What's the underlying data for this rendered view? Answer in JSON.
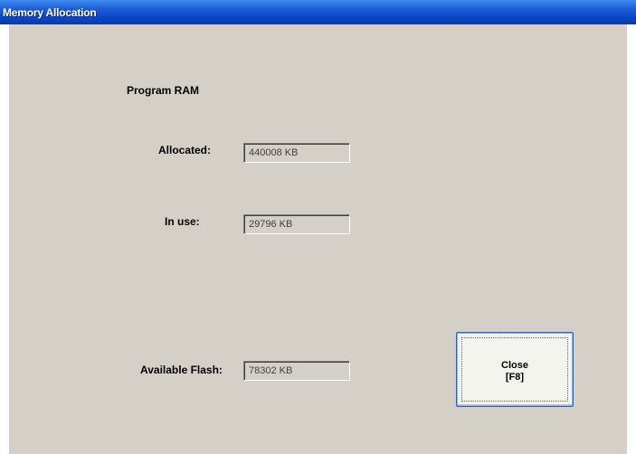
{
  "window": {
    "title": "Memory Allocation"
  },
  "program_ram": {
    "heading": "Program RAM",
    "allocated_label": "Allocated:",
    "allocated_value": "440008 KB",
    "in_use_label": "In use:",
    "in_use_value": "29796 KB"
  },
  "flash": {
    "available_label": "Available Flash:",
    "available_value": "78302 KB"
  },
  "close_button": {
    "line1": "Close",
    "line2": "[F8]"
  },
  "colors": {
    "titlebar": "#0a47c7",
    "client_background": "#d4d0c8",
    "button_border": "#2a5fc4"
  }
}
